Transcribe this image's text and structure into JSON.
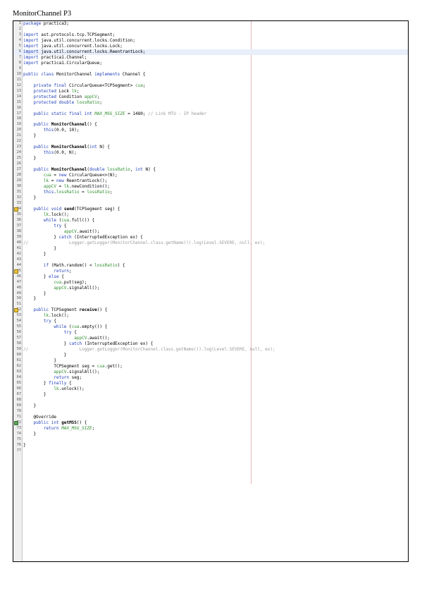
{
  "document": {
    "title": "MonitorChannel P3"
  },
  "code_lines": [
    {
      "n": "1",
      "t": "package practica3;"
    },
    {
      "n": "2",
      "t": ""
    },
    {
      "n": "3",
      "t": "import ast.protocols.tcp.TCPSegment;"
    },
    {
      "n": "4",
      "t": "import java.util.concurrent.locks.Condition;"
    },
    {
      "n": "5",
      "t": "import java.util.concurrent.locks.Lock;"
    },
    {
      "n": "6",
      "t": "import java.util.concurrent.locks.ReentrantLock;"
    },
    {
      "n": "7",
      "t": "import practica1.Channel;"
    },
    {
      "n": "8",
      "t": "import practica1.CircularQueue;"
    },
    {
      "n": "9",
      "t": ""
    },
    {
      "n": "10",
      "t": "public class MonitorChannel implements Channel {"
    },
    {
      "n": "11",
      "t": ""
    },
    {
      "n": "12",
      "t": "    private final CircularQueue<TCPSegment> cua;"
    },
    {
      "n": "13",
      "t": "    protected Lock lk;"
    },
    {
      "n": "14",
      "t": "    protected Condition appCV;"
    },
    {
      "n": "15",
      "t": "    protected double lossRatio;"
    },
    {
      "n": "16",
      "t": ""
    },
    {
      "n": "17",
      "t": "    public static final int MAX_MSG_SIZE = 1480; // Link MTU - IP header"
    },
    {
      "n": "18",
      "t": ""
    },
    {
      "n": "19",
      "t": "    public MonitorChannel() {"
    },
    {
      "n": "20",
      "t": "        this(0.0, 10);"
    },
    {
      "n": "21",
      "t": "    }"
    },
    {
      "n": "22",
      "t": ""
    },
    {
      "n": "23",
      "t": "    public MonitorChannel(int N) {"
    },
    {
      "n": "24",
      "t": "        this(0.0, N);"
    },
    {
      "n": "25",
      "t": "    }"
    },
    {
      "n": "26",
      "t": ""
    },
    {
      "n": "27",
      "t": "    public MonitorChannel(double lossRatio, int N) {"
    },
    {
      "n": "28",
      "t": "        cua = new CircularQueue<>(N);"
    },
    {
      "n": "29",
      "t": "        lk = new ReentrantLock();"
    },
    {
      "n": "30",
      "t": "        appCV = lk.newCondition();"
    },
    {
      "n": "31",
      "t": "        this.lossRatio = lossRatio;"
    },
    {
      "n": "32",
      "t": "    }"
    },
    {
      "n": "33",
      "t": ""
    },
    {
      "n": "34",
      "t": "    public void send(TCPSegment seg) {"
    },
    {
      "n": "35",
      "t": "        lk.lock();"
    },
    {
      "n": "36",
      "t": "        while (cua.full()) {"
    },
    {
      "n": "37",
      "t": "            try {"
    },
    {
      "n": "38",
      "t": "                appCV.await();"
    },
    {
      "n": "39",
      "t": "            } catch (InterruptedException ex) {"
    },
    {
      "n": "40",
      "t": "//                Logger.getLogger(MonitorChannel.class.getName()).log(Level.SEVERE, null, ex);"
    },
    {
      "n": "41",
      "t": "            }"
    },
    {
      "n": "42",
      "t": "        }"
    },
    {
      "n": "43",
      "t": ""
    },
    {
      "n": "44",
      "t": "        if (Math.random() < lossRatio) {"
    },
    {
      "n": "45",
      "t": "            return;"
    },
    {
      "n": "46",
      "t": "        } else {"
    },
    {
      "n": "47",
      "t": "            cua.put(seg);"
    },
    {
      "n": "48",
      "t": "            appCV.signalAll();"
    },
    {
      "n": "49",
      "t": "        }"
    },
    {
      "n": "50",
      "t": "    }"
    },
    {
      "n": "51",
      "t": ""
    },
    {
      "n": "52",
      "t": "    public TCPSegment receive() {"
    },
    {
      "n": "53",
      "t": "        lk.lock();"
    },
    {
      "n": "54",
      "t": "        try {"
    },
    {
      "n": "55",
      "t": "            while (cua.empty()) {"
    },
    {
      "n": "56",
      "t": "                try {"
    },
    {
      "n": "57",
      "t": "                    appCV.await();"
    },
    {
      "n": "58",
      "t": "                } catch (InterruptedException ex) {"
    },
    {
      "n": "59",
      "t": "//                    Logger.getLogger(MonitorChannel.class.getName()).log(Level.SEVERE, null, ex);"
    },
    {
      "n": "60",
      "t": "                }"
    },
    {
      "n": "61",
      "t": "            }"
    },
    {
      "n": "62",
      "t": "            TCPSegment seg = cua.get();"
    },
    {
      "n": "63",
      "t": "            appCV.signalAll();"
    },
    {
      "n": "64",
      "t": "            return seg;"
    },
    {
      "n": "65",
      "t": "        } finally {"
    },
    {
      "n": "66",
      "t": "            lk.unlock();"
    },
    {
      "n": "67",
      "t": "        }"
    },
    {
      "n": "68",
      "t": ""
    },
    {
      "n": "69",
      "t": "    }"
    },
    {
      "n": "70",
      "t": ""
    },
    {
      "n": "71",
      "t": "    @Override"
    },
    {
      "n": "72",
      "t": "    public int getMSS() {"
    },
    {
      "n": "73",
      "t": "        return MAX_MSG_SIZE;"
    },
    {
      "n": "74",
      "t": "    }"
    },
    {
      "n": "75",
      "t": ""
    },
    {
      "n": "76",
      "t": "}"
    },
    {
      "n": "77",
      "t": ""
    }
  ],
  "markers": {
    "34": "warning",
    "45": "warning",
    "52": "warning",
    "72": "override"
  },
  "highlighted_line": "6",
  "colors": {
    "keyword": "#1f3fb8",
    "field": "#2f8f2f",
    "comment": "#9a9a9a",
    "highlight": "#e8eefa"
  }
}
